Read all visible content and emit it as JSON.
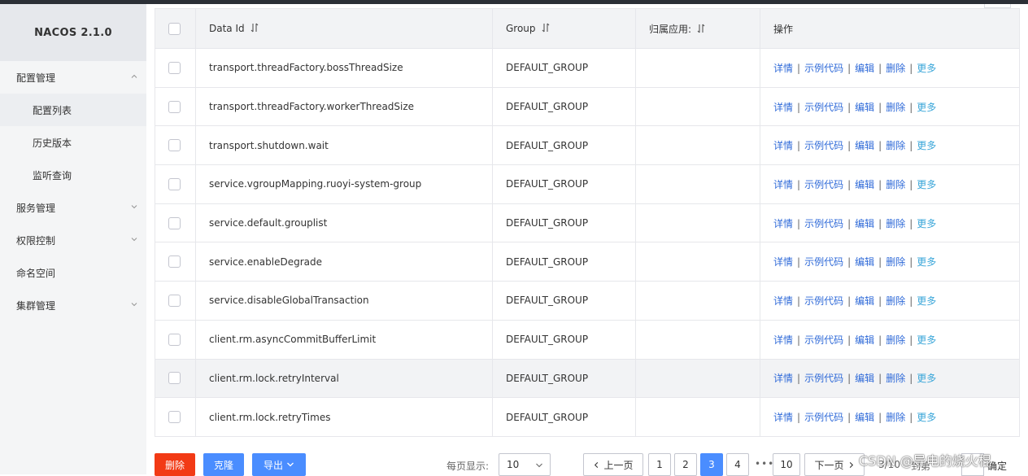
{
  "brand": "NACOS 2.1.0",
  "sidebar": {
    "items": [
      {
        "label": "配置管理"
      },
      {
        "label": "配置列表"
      },
      {
        "label": "历史版本"
      },
      {
        "label": "监听查询"
      },
      {
        "label": "服务管理"
      },
      {
        "label": "权限控制"
      },
      {
        "label": "命名空间"
      },
      {
        "label": "集群管理"
      }
    ]
  },
  "table": {
    "headers": {
      "data_id": "Data Id",
      "group": "Group",
      "app": "归属应用:",
      "ops": "操作"
    },
    "rows": [
      {
        "data_id": "transport.threadFactory.bossThreadSize",
        "group": "DEFAULT_GROUP",
        "app": ""
      },
      {
        "data_id": "transport.threadFactory.workerThreadSize",
        "group": "DEFAULT_GROUP",
        "app": ""
      },
      {
        "data_id": "transport.shutdown.wait",
        "group": "DEFAULT_GROUP",
        "app": ""
      },
      {
        "data_id": "service.vgroupMapping.ruoyi-system-group",
        "group": "DEFAULT_GROUP",
        "app": ""
      },
      {
        "data_id": "service.default.grouplist",
        "group": "DEFAULT_GROUP",
        "app": ""
      },
      {
        "data_id": "service.enableDegrade",
        "group": "DEFAULT_GROUP",
        "app": ""
      },
      {
        "data_id": "service.disableGlobalTransaction",
        "group": "DEFAULT_GROUP",
        "app": ""
      },
      {
        "data_id": "client.rm.asyncCommitBufferLimit",
        "group": "DEFAULT_GROUP",
        "app": ""
      },
      {
        "data_id": "client.rm.lock.retryInterval",
        "group": "DEFAULT_GROUP",
        "app": ""
      },
      {
        "data_id": "client.rm.lock.retryTimes",
        "group": "DEFAULT_GROUP",
        "app": ""
      }
    ],
    "ops": {
      "detail": "详情",
      "sample": "示例代码",
      "edit": "编辑",
      "delete": "删除",
      "more": "更多",
      "sep": "|"
    }
  },
  "footer": {
    "delete_label": "删除",
    "clone_label": "克隆",
    "export_label": "导出",
    "per_page_label": "每页显示:",
    "per_page_value": "10",
    "prev_label": "上一页",
    "next_label": "下一页",
    "pages": [
      "1",
      "2",
      "3",
      "4",
      "10"
    ],
    "current_page": "3",
    "ellipsis": "•••",
    "page_info": "3/10",
    "goto_label": "到第",
    "confirm_label": "确定"
  },
  "watermark": "CSDN @导电的烧火棍",
  "colors": {
    "primary": "#4a8dff",
    "danger": "#f23a15",
    "link": "#2f6ad8"
  }
}
